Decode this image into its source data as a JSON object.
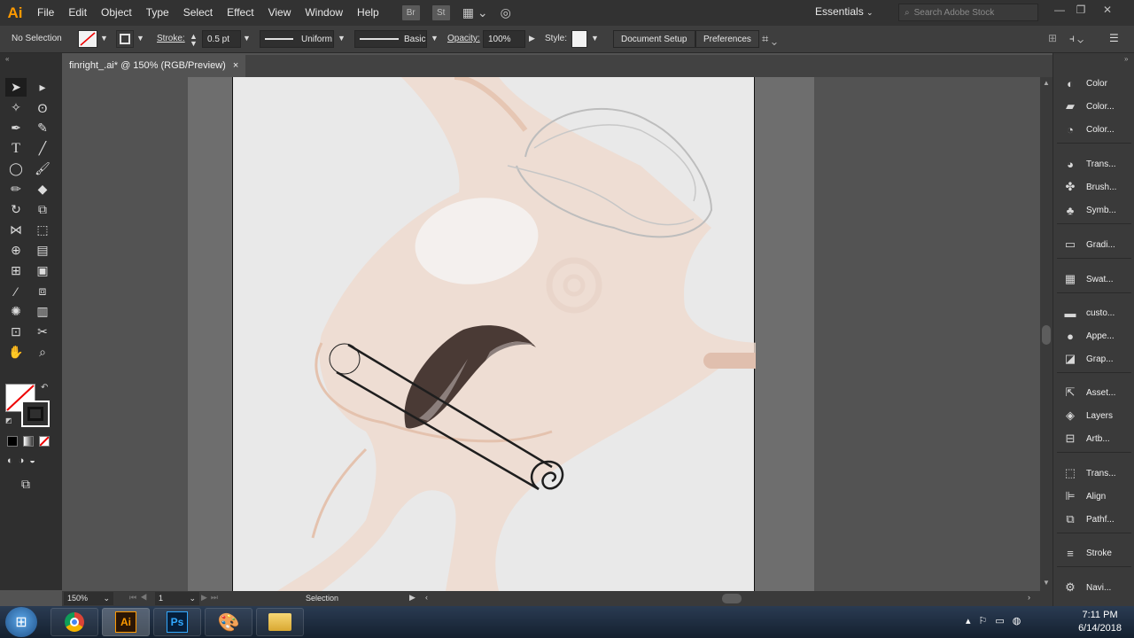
{
  "app": {
    "logo": "Ai"
  },
  "menu": [
    "File",
    "Edit",
    "Object",
    "Type",
    "Select",
    "Effect",
    "View",
    "Window",
    "Help"
  ],
  "menu_icons": {
    "bridge": "Br",
    "stock": "St"
  },
  "workspace": {
    "label": "Essentials"
  },
  "search": {
    "placeholder": "Search Adobe Stock"
  },
  "control": {
    "selection": "No Selection",
    "stroke_label": "Stroke:",
    "stroke_weight": "0.5 pt",
    "profile": "Uniform",
    "brush": "Basic",
    "opacity_label": "Opacity:",
    "opacity_value": "100%",
    "style_label": "Style:",
    "doc_setup": "Document Setup",
    "preferences": "Preferences"
  },
  "document": {
    "tab_title": "finright_.ai* @ 150% (RGB/Preview)",
    "close": "×"
  },
  "status": {
    "zoom": "150%",
    "artboard": "1",
    "mode": "Selection"
  },
  "panels": [
    "Color",
    "Color...",
    "Color...",
    "Trans...",
    "Brush...",
    "Symb...",
    "Gradi...",
    "Swat...",
    "custo...",
    "Appe...",
    "Grap...",
    "Asset...",
    "Layers",
    "Artb...",
    "Trans...",
    "Align",
    "Pathf...",
    "Stroke",
    "Navi..."
  ],
  "taskbar": {
    "ai": "Ai",
    "ps": "Ps",
    "time": "7:11 PM",
    "date": "6/14/2018"
  },
  "colors": {
    "accent": "#ff9a00",
    "sketch_fill": "#efd9cd",
    "sketch_line": "#e8c9b7",
    "leaf_dark": "#4a3a35",
    "leaf_light": "#8c7f7c"
  }
}
